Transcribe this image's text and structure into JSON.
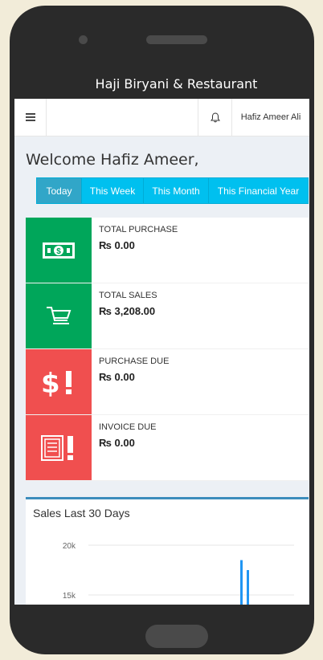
{
  "app": {
    "title": "Haji Biryani & Restaurant"
  },
  "topbar": {
    "user_name": "Hafiz Ameer Ali"
  },
  "welcome": "Welcome Hafiz Ameer,",
  "tabs": [
    {
      "label": "Today",
      "active": true
    },
    {
      "label": "This Week",
      "active": false
    },
    {
      "label": "This Month",
      "active": false
    },
    {
      "label": "This Financial Year",
      "active": false
    }
  ],
  "stats": [
    {
      "label": "TOTAL PURCHASE",
      "value": "₨ 0.00",
      "color": "#00a65a",
      "icon": "money-icon"
    },
    {
      "label": "TOTAL SALES",
      "value": "₨ 3,208.00",
      "color": "#00a65a",
      "icon": "cart-icon"
    },
    {
      "label": "PURCHASE DUE",
      "value": "₨ 0.00",
      "color": "#f04f4f",
      "icon": "dollar-alert-icon"
    },
    {
      "label": "INVOICE DUE",
      "value": "₨ 0.00",
      "color": "#f04f4f",
      "icon": "invoice-alert-icon"
    }
  ],
  "chart_panel": {
    "title": "Sales Last 30 Days"
  },
  "chart_data": {
    "type": "bar",
    "yticks": [
      "20k",
      "15k"
    ],
    "ylim": [
      0,
      20000
    ],
    "series": [
      {
        "values": [
          18500,
          17500
        ]
      }
    ],
    "color": "#2196f3",
    "grid": true
  }
}
